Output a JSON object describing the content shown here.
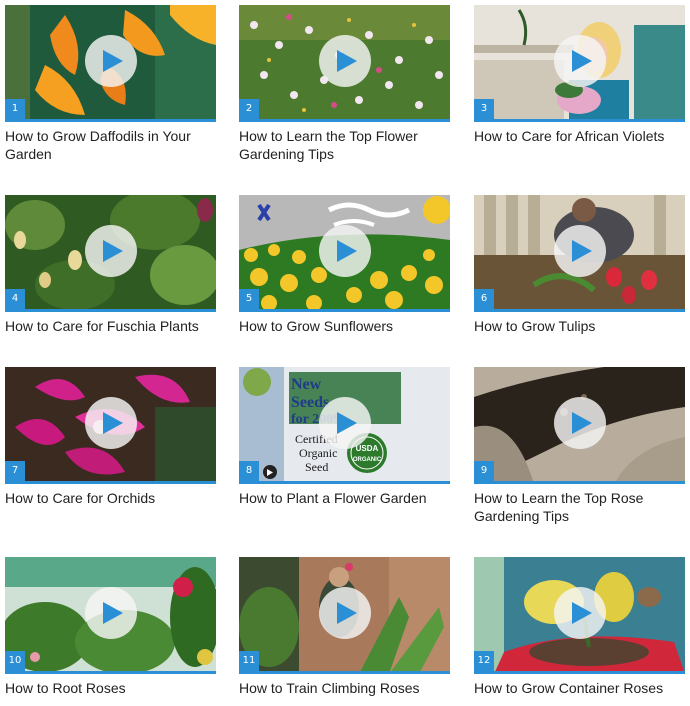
{
  "videos": [
    {
      "number": "1",
      "title": "How to Grow Daffodils in Your Garden"
    },
    {
      "number": "2",
      "title": "How to Learn the Top Flower Gardening Tips"
    },
    {
      "number": "3",
      "title": "How to Care for African Violets"
    },
    {
      "number": "4",
      "title": "How to Care for Fuschia Plants"
    },
    {
      "number": "5",
      "title": "How to Grow Sunflowers"
    },
    {
      "number": "6",
      "title": "How to Grow Tulips"
    },
    {
      "number": "7",
      "title": "How to Care for Orchids"
    },
    {
      "number": "8",
      "title": "How to Plant a Flower Garden"
    },
    {
      "number": "9",
      "title": "How to Learn the Top Rose Gardening Tips"
    },
    {
      "number": "10",
      "title": "How to Root Roses"
    },
    {
      "number": "11",
      "title": "How to Train Climbing Roses"
    },
    {
      "number": "12",
      "title": "How to Grow Container Roses"
    }
  ],
  "thumb8_sign": {
    "line1": "New",
    "line2": "Seeds",
    "line3": "for 2009",
    "line4": "Certified",
    "line5": "Organic",
    "line6": "Seed",
    "badge_top": "USDA",
    "badge_bottom": "ORGANIC"
  },
  "colors": {
    "accent": "#2b8fd6",
    "play_triangle": "#2b8fd6",
    "title_text": "#222222"
  },
  "icons": {
    "play": "play-icon"
  }
}
